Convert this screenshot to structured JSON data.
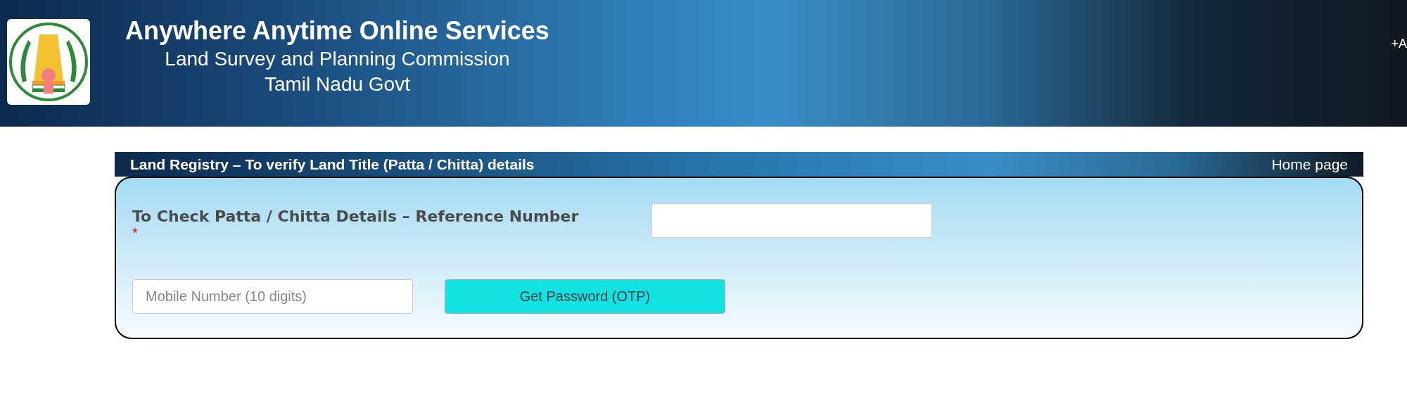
{
  "header": {
    "title": "Anywhere Anytime Online Services",
    "subtitle": "Land Survey and Planning Commission",
    "government": "Tamil Nadu Govt",
    "font_size_control": "+A"
  },
  "panel": {
    "title": "Land Registry – To verify Land Title (Patta / Chitta) details",
    "home_link": "Home page",
    "reference_label": "To Check Patta / Chitta Details – Reference Number",
    "required_mark": "*",
    "mobile_field": {
      "placeholder": "Mobile Number (10 digits)"
    },
    "otp_button": "Get Password (OTP)"
  }
}
